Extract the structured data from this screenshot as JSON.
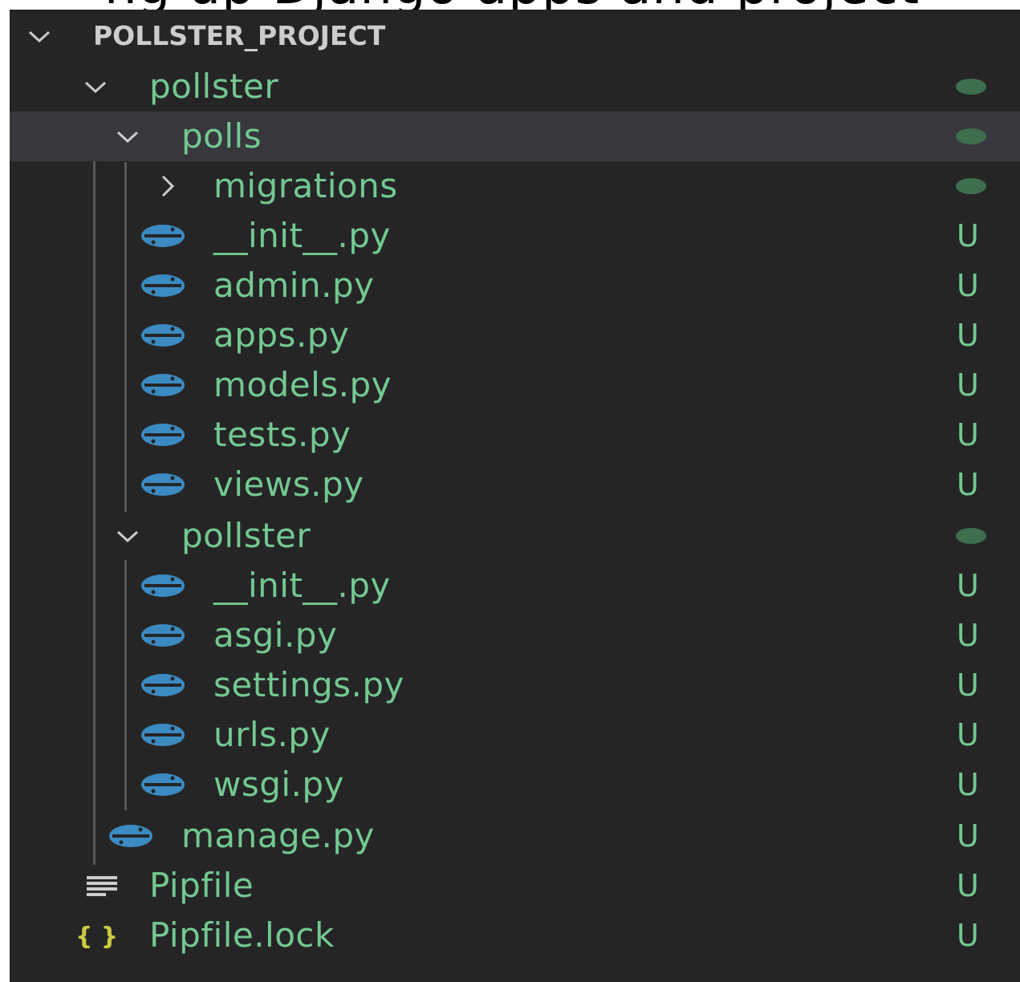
{
  "colors": {
    "background": "#252526",
    "selected_row": "#37373d",
    "untracked_text": "#73c991",
    "root_text": "#cccccc",
    "python_icon": "#3b8bc2",
    "folder_dot": "#3d6e4e",
    "json_icon": "#cbcb41",
    "indent_guide": "#585858"
  },
  "top_banner": {
    "cut_text": "ng up Django apps and project"
  },
  "tree": {
    "root": {
      "label": "POLLSTER_PROJECT",
      "icon": "chevron-down-icon"
    },
    "items": [
      {
        "label": "pollster",
        "kind": "folder",
        "expanded": true,
        "icon": "chevron-down-icon",
        "status": "dot"
      },
      {
        "label": "polls",
        "kind": "folder",
        "expanded": true,
        "icon": "chevron-down-icon",
        "status": "dot",
        "selected": true
      },
      {
        "label": "migrations",
        "kind": "folder",
        "expanded": false,
        "icon": "chevron-right-icon",
        "status": "dot"
      },
      {
        "label": "__init__.py",
        "kind": "file",
        "icon": "python-icon",
        "status": "U"
      },
      {
        "label": "admin.py",
        "kind": "file",
        "icon": "python-icon",
        "status": "U"
      },
      {
        "label": "apps.py",
        "kind": "file",
        "icon": "python-icon",
        "status": "U"
      },
      {
        "label": "models.py",
        "kind": "file",
        "icon": "python-icon",
        "status": "U"
      },
      {
        "label": "tests.py",
        "kind": "file",
        "icon": "python-icon",
        "status": "U"
      },
      {
        "label": "views.py",
        "kind": "file",
        "icon": "python-icon",
        "status": "U"
      },
      {
        "label": "pollster",
        "kind": "folder",
        "expanded": true,
        "icon": "chevron-down-icon",
        "status": "dot"
      },
      {
        "label": "__init__.py",
        "kind": "file",
        "icon": "python-icon",
        "status": "U"
      },
      {
        "label": "asgi.py",
        "kind": "file",
        "icon": "python-icon",
        "status": "U"
      },
      {
        "label": "settings.py",
        "kind": "file",
        "icon": "python-icon",
        "status": "U"
      },
      {
        "label": "urls.py",
        "kind": "file",
        "icon": "python-icon",
        "status": "U"
      },
      {
        "label": "wsgi.py",
        "kind": "file",
        "icon": "python-icon",
        "status": "U"
      },
      {
        "label": "manage.py",
        "kind": "file",
        "icon": "python-icon",
        "status": "U"
      },
      {
        "label": "Pipfile",
        "kind": "file",
        "icon": "lines-icon",
        "status": "U"
      },
      {
        "label": "Pipfile.lock",
        "kind": "file",
        "icon": "json-braces-icon",
        "status": "U"
      }
    ]
  }
}
